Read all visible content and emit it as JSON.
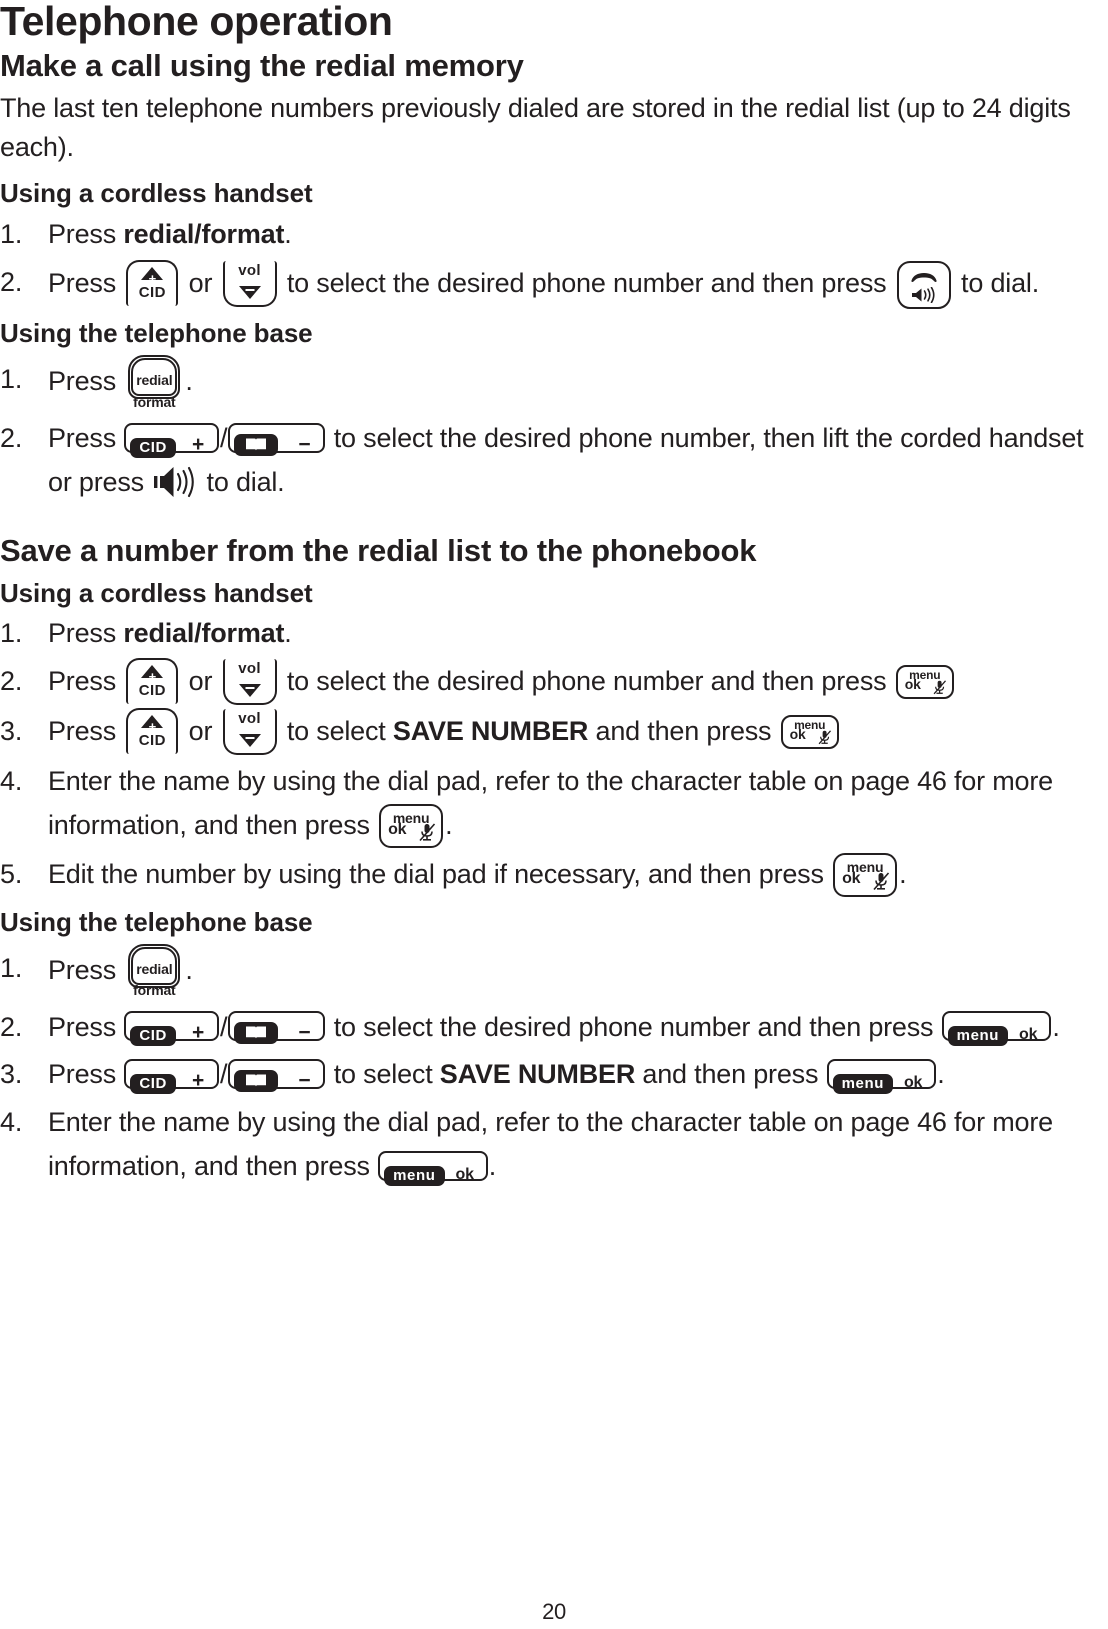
{
  "document": {
    "title": "Telephone operation",
    "page_number": "20"
  },
  "sections": [
    {
      "heading": "Make a call using the redial memory",
      "intro": "The last ten telephone numbers previously dialed are stored in the redial list (up to 24 digits each).",
      "sub1": "Using a cordless handset",
      "sub2": "Using the telephone base"
    },
    {
      "heading": "Save a number from the redial list to the phonebook",
      "sub1": "Using a cordless handset",
      "sub2": "Using the telephone base"
    }
  ],
  "steps": {
    "s1_1_num": "1.",
    "s1_1_a": "Press ",
    "s1_1_b": "redial/format",
    "s1_1_c": ".",
    "s1_2_num": "2.",
    "s1_2_a": "Press ",
    "s1_2_b": " or ",
    "s1_2_c": " to select the desired phone number and then press ",
    "s1_2_d": " to dial.",
    "s2_1_num": "1.",
    "s2_1_a": "Press ",
    "s2_1_b": ".",
    "s2_2_num": "2.",
    "s2_2_a": "Press ",
    "s2_2_b": "/",
    "s2_2_c": " to select the desired phone number, then lift the corded handset or press ",
    "s2_2_d": " to dial.",
    "s3_1_num": "1.",
    "s3_1_a": "Press ",
    "s3_1_b": "redial/format",
    "s3_1_c": ".",
    "s3_2_num": "2.",
    "s3_2_a": "Press ",
    "s3_2_b": " or ",
    "s3_2_c": " to select the desired phone number and then press ",
    "s3_2_d": ".",
    "s3_3_num": "3.",
    "s3_3_a": "Press ",
    "s3_3_b": " or ",
    "s3_3_c": " to select ",
    "s3_3_bold": "SAVE NUMBER",
    "s3_3_d": " and then press ",
    "s3_4_num": "4.",
    "s3_4_a": "Enter the name by using the dial pad, refer to the character table on page 46 for more information, and then press ",
    "s3_4_b": ".",
    "s3_5_num": "5.",
    "s3_5_a": "Edit the number by using the dial pad if necessary, and then press ",
    "s3_5_b": ".",
    "s4_1_num": "1.",
    "s4_1_a": "Press ",
    "s4_1_b": ".",
    "s4_2_num": "2.",
    "s4_2_a": "Press ",
    "s4_2_b": "/",
    "s4_2_c": " to select the desired phone number and then press ",
    "s4_2_d": ".",
    "s4_3_num": "3.",
    "s4_3_a": "Press ",
    "s4_3_b": "/",
    "s4_3_c": " to select ",
    "s4_3_bold": "SAVE NUMBER",
    "s4_3_d": " and then press ",
    "s4_3_e": ".",
    "s4_4_num": "4.",
    "s4_4_a": "Enter the name by using the dial pad, refer to the character table on page 46 for more information, and then press ",
    "s4_4_b": "."
  },
  "keys": {
    "cid_label": "CID",
    "vol_label": "vol",
    "redial_label": "redial",
    "format_label": "format",
    "menu_label": "menu",
    "ok_label": "ok",
    "plus_sign": "+",
    "minus_sign": "−",
    "base_menu_badge": "menu",
    "base_ok_label": "ok"
  },
  "colors": {
    "ink": "#231f20",
    "paper": "#ffffff"
  }
}
